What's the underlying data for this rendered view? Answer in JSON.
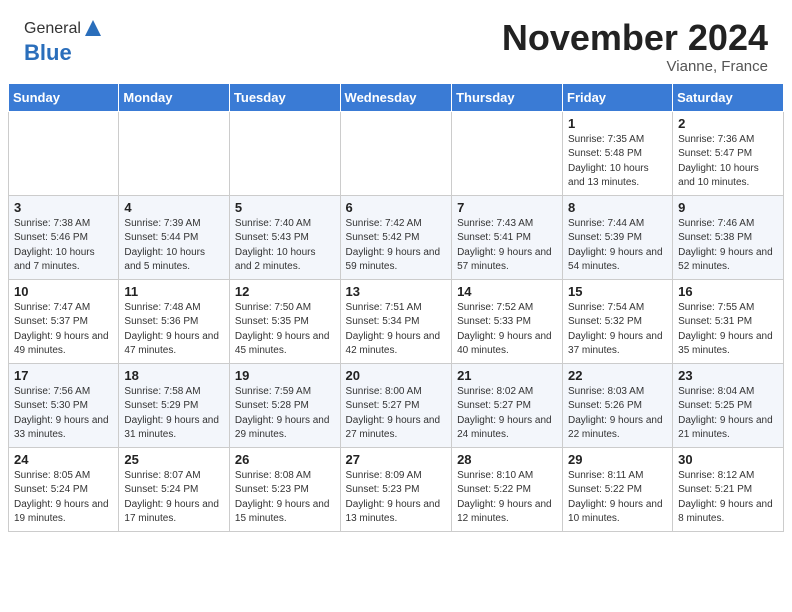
{
  "header": {
    "logo_general": "General",
    "logo_blue": "Blue",
    "month_title": "November 2024",
    "location": "Vianne, France"
  },
  "weekdays": [
    "Sunday",
    "Monday",
    "Tuesday",
    "Wednesday",
    "Thursday",
    "Friday",
    "Saturday"
  ],
  "weeks": [
    [
      {
        "day": "",
        "info": ""
      },
      {
        "day": "",
        "info": ""
      },
      {
        "day": "",
        "info": ""
      },
      {
        "day": "",
        "info": ""
      },
      {
        "day": "",
        "info": ""
      },
      {
        "day": "1",
        "info": "Sunrise: 7:35 AM\nSunset: 5:48 PM\nDaylight: 10 hours and 13 minutes."
      },
      {
        "day": "2",
        "info": "Sunrise: 7:36 AM\nSunset: 5:47 PM\nDaylight: 10 hours and 10 minutes."
      }
    ],
    [
      {
        "day": "3",
        "info": "Sunrise: 7:38 AM\nSunset: 5:46 PM\nDaylight: 10 hours and 7 minutes."
      },
      {
        "day": "4",
        "info": "Sunrise: 7:39 AM\nSunset: 5:44 PM\nDaylight: 10 hours and 5 minutes."
      },
      {
        "day": "5",
        "info": "Sunrise: 7:40 AM\nSunset: 5:43 PM\nDaylight: 10 hours and 2 minutes."
      },
      {
        "day": "6",
        "info": "Sunrise: 7:42 AM\nSunset: 5:42 PM\nDaylight: 9 hours and 59 minutes."
      },
      {
        "day": "7",
        "info": "Sunrise: 7:43 AM\nSunset: 5:41 PM\nDaylight: 9 hours and 57 minutes."
      },
      {
        "day": "8",
        "info": "Sunrise: 7:44 AM\nSunset: 5:39 PM\nDaylight: 9 hours and 54 minutes."
      },
      {
        "day": "9",
        "info": "Sunrise: 7:46 AM\nSunset: 5:38 PM\nDaylight: 9 hours and 52 minutes."
      }
    ],
    [
      {
        "day": "10",
        "info": "Sunrise: 7:47 AM\nSunset: 5:37 PM\nDaylight: 9 hours and 49 minutes."
      },
      {
        "day": "11",
        "info": "Sunrise: 7:48 AM\nSunset: 5:36 PM\nDaylight: 9 hours and 47 minutes."
      },
      {
        "day": "12",
        "info": "Sunrise: 7:50 AM\nSunset: 5:35 PM\nDaylight: 9 hours and 45 minutes."
      },
      {
        "day": "13",
        "info": "Sunrise: 7:51 AM\nSunset: 5:34 PM\nDaylight: 9 hours and 42 minutes."
      },
      {
        "day": "14",
        "info": "Sunrise: 7:52 AM\nSunset: 5:33 PM\nDaylight: 9 hours and 40 minutes."
      },
      {
        "day": "15",
        "info": "Sunrise: 7:54 AM\nSunset: 5:32 PM\nDaylight: 9 hours and 37 minutes."
      },
      {
        "day": "16",
        "info": "Sunrise: 7:55 AM\nSunset: 5:31 PM\nDaylight: 9 hours and 35 minutes."
      }
    ],
    [
      {
        "day": "17",
        "info": "Sunrise: 7:56 AM\nSunset: 5:30 PM\nDaylight: 9 hours and 33 minutes."
      },
      {
        "day": "18",
        "info": "Sunrise: 7:58 AM\nSunset: 5:29 PM\nDaylight: 9 hours and 31 minutes."
      },
      {
        "day": "19",
        "info": "Sunrise: 7:59 AM\nSunset: 5:28 PM\nDaylight: 9 hours and 29 minutes."
      },
      {
        "day": "20",
        "info": "Sunrise: 8:00 AM\nSunset: 5:27 PM\nDaylight: 9 hours and 27 minutes."
      },
      {
        "day": "21",
        "info": "Sunrise: 8:02 AM\nSunset: 5:27 PM\nDaylight: 9 hours and 24 minutes."
      },
      {
        "day": "22",
        "info": "Sunrise: 8:03 AM\nSunset: 5:26 PM\nDaylight: 9 hours and 22 minutes."
      },
      {
        "day": "23",
        "info": "Sunrise: 8:04 AM\nSunset: 5:25 PM\nDaylight: 9 hours and 21 minutes."
      }
    ],
    [
      {
        "day": "24",
        "info": "Sunrise: 8:05 AM\nSunset: 5:24 PM\nDaylight: 9 hours and 19 minutes."
      },
      {
        "day": "25",
        "info": "Sunrise: 8:07 AM\nSunset: 5:24 PM\nDaylight: 9 hours and 17 minutes."
      },
      {
        "day": "26",
        "info": "Sunrise: 8:08 AM\nSunset: 5:23 PM\nDaylight: 9 hours and 15 minutes."
      },
      {
        "day": "27",
        "info": "Sunrise: 8:09 AM\nSunset: 5:23 PM\nDaylight: 9 hours and 13 minutes."
      },
      {
        "day": "28",
        "info": "Sunrise: 8:10 AM\nSunset: 5:22 PM\nDaylight: 9 hours and 12 minutes."
      },
      {
        "day": "29",
        "info": "Sunrise: 8:11 AM\nSunset: 5:22 PM\nDaylight: 9 hours and 10 minutes."
      },
      {
        "day": "30",
        "info": "Sunrise: 8:12 AM\nSunset: 5:21 PM\nDaylight: 9 hours and 8 minutes."
      }
    ]
  ]
}
